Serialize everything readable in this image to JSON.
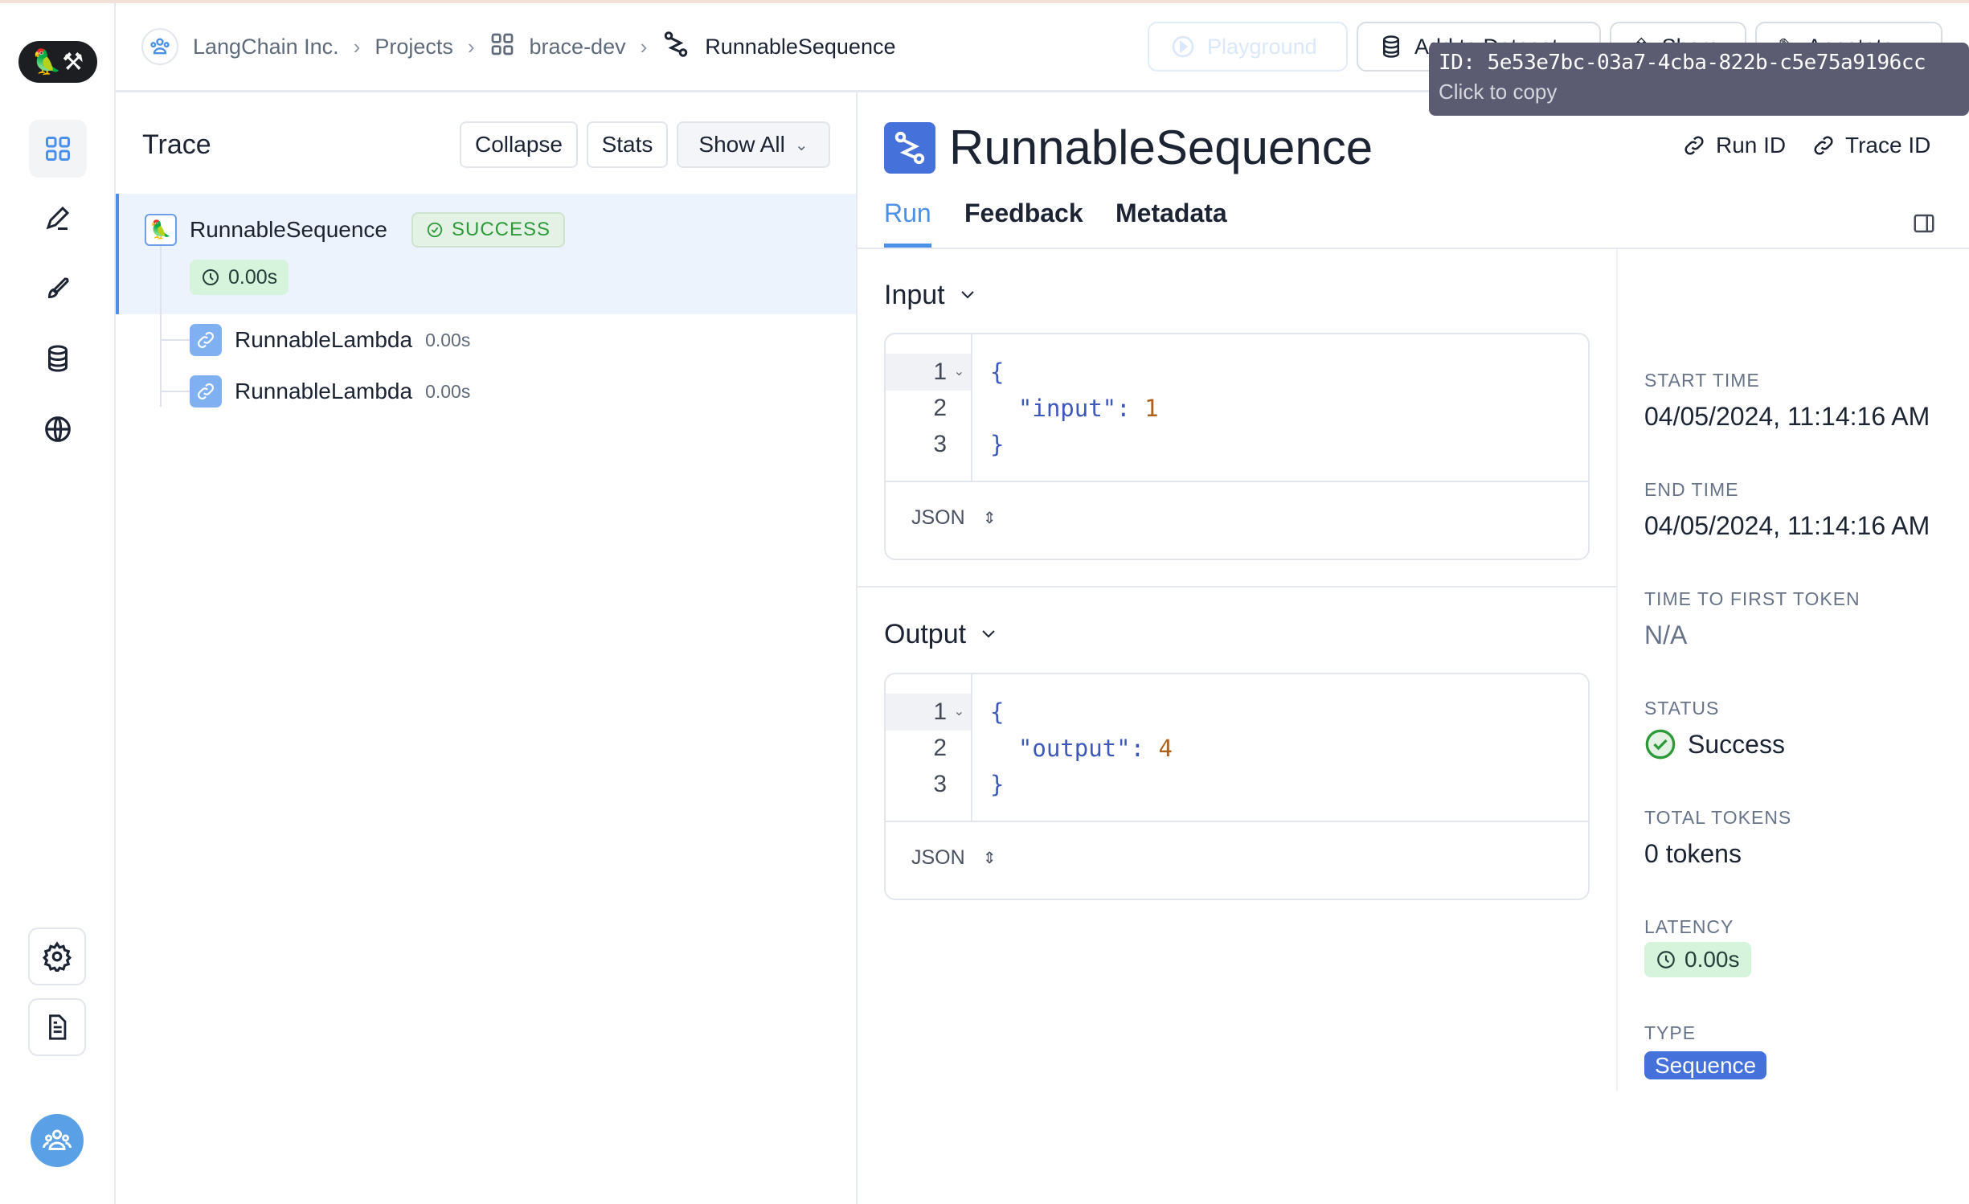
{
  "tooltip": {
    "id": "ID: 5e53e7bc-03a7-4cba-822b-c5e75a9196cc",
    "hint": "Click to copy"
  },
  "breadcrumb": [
    "LangChain Inc.",
    "Projects",
    "brace-dev",
    "RunnableSequence"
  ],
  "header_buttons": {
    "playground": "Playground",
    "add_to_dataset": "Add to Dataset",
    "share": "Share",
    "annotate": "Annotate"
  },
  "trace": {
    "title": "Trace",
    "collapse": "Collapse",
    "stats": "Stats",
    "show_all": "Show All",
    "root": {
      "name": "RunnableSequence",
      "status": "SUCCESS",
      "latency": "0.00s"
    },
    "children": [
      {
        "name": "RunnableLambda",
        "latency": "0.00s"
      },
      {
        "name": "RunnableLambda",
        "latency": "0.00s"
      }
    ]
  },
  "run": {
    "title": "RunnableSequence",
    "run_id": "Run ID",
    "trace_id": "Trace ID",
    "tabs": [
      "Run",
      "Feedback",
      "Metadata"
    ],
    "input": {
      "label": "Input",
      "lines": [
        "{",
        "  \"input\": ",
        "}"
      ],
      "value": "1",
      "lang": "JSON"
    },
    "output": {
      "label": "Output",
      "lines": [
        "{",
        "  \"output\": ",
        "}"
      ],
      "value": "4",
      "lang": "JSON"
    }
  },
  "metadata": {
    "start_time_label": "START TIME",
    "start_time": "04/05/2024, 11:14:16 AM",
    "end_time_label": "END TIME",
    "end_time": "04/05/2024, 11:14:16 AM",
    "ttft_label": "TIME TO FIRST TOKEN",
    "ttft": "N/A",
    "status_label": "STATUS",
    "status": "Success",
    "tokens_label": "TOTAL TOKENS",
    "tokens": "0 tokens",
    "latency_label": "LATENCY",
    "latency": "0.00s",
    "type_label": "TYPE",
    "type": "Sequence"
  },
  "colors": {
    "accent": "#4a8fe8",
    "success": "#2d9a3a",
    "type_badge": "#4571db"
  }
}
